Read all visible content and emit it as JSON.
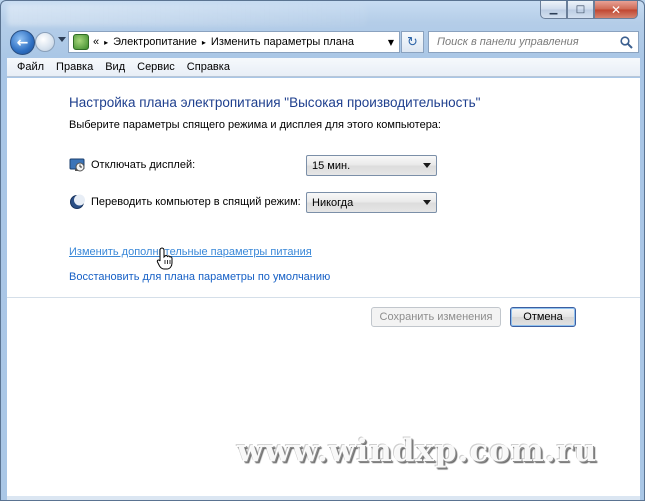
{
  "window": {
    "caption_buttons": {
      "minimize": "▁",
      "maximize": "□",
      "close": "✕"
    }
  },
  "navigation": {
    "back_icon": "back-arrow-icon",
    "forward_icon": "forward-arrow-icon",
    "back_glyph": "←",
    "address": {
      "overflow_glyph": "«",
      "crumbs": [
        "Электропитание",
        "Изменить параметры плана"
      ],
      "separator": "▸",
      "dropdown_glyph": "▼"
    },
    "refresh_glyph": "↻",
    "search_placeholder": "Поиск в панели управления"
  },
  "menu": {
    "items": [
      "Файл",
      "Правка",
      "Вид",
      "Сервис",
      "Справка"
    ]
  },
  "main": {
    "title": "Настройка плана электропитания \"Высокая производительность\"",
    "subtitle": "Выберите параметры спящего режима и дисплея для этого компьютера:",
    "settings": [
      {
        "icon": "display-off-icon",
        "label": "Отключать дисплей:",
        "value": "15 мин."
      },
      {
        "icon": "sleep-moon-icon",
        "label": "Переводить компьютер в спящий режим:",
        "value": "Никогда"
      }
    ],
    "links": {
      "advanced": "Изменить дополнительные параметры питания",
      "restore": "Восстановить для плана параметры по умолчанию"
    },
    "buttons": {
      "save": "Сохранить изменения",
      "cancel": "Отмена"
    },
    "save_enabled": false
  },
  "watermark": "www.windxp.com.ru",
  "colors": {
    "title_text": "#1e3f8e",
    "link": "#1660c6",
    "link_hover": "#3a88d8",
    "window_frame": "#aac7e6",
    "close_button": "#c04630"
  }
}
